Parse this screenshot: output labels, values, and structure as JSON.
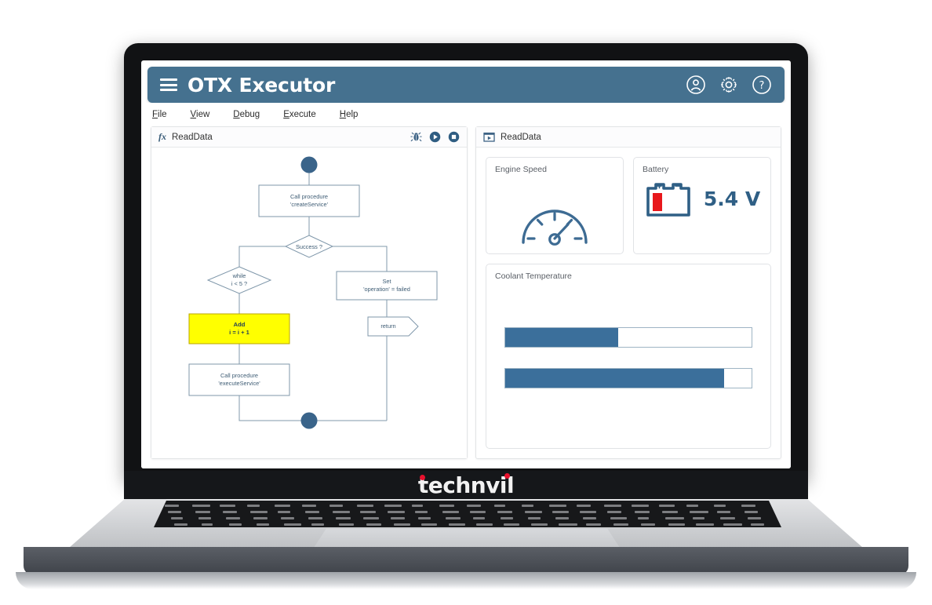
{
  "app": {
    "title": "OTX Executor",
    "menu_icon": "hamburger-icon",
    "header_icons": [
      {
        "name": "account-icon",
        "label": "Account"
      },
      {
        "name": "settings-gear-icon",
        "label": "Settings"
      },
      {
        "name": "help-icon",
        "label": "Help"
      }
    ],
    "menubar": [
      {
        "label": "File",
        "accel": "F"
      },
      {
        "label": "View",
        "accel": "V"
      },
      {
        "label": "Debug",
        "accel": "D"
      },
      {
        "label": "Execute",
        "accel": "E"
      },
      {
        "label": "Help",
        "accel": "H"
      }
    ]
  },
  "editor_panel": {
    "icon": "fx-icon",
    "fx_label": "fx",
    "title": "ReadData",
    "tools": [
      {
        "name": "debug-bug-icon",
        "label": "Debug"
      },
      {
        "name": "run-play-icon",
        "label": "Run"
      },
      {
        "name": "stop-square-icon",
        "label": "Stop"
      }
    ],
    "flow": {
      "nodes": [
        {
          "id": "start",
          "type": "start-node",
          "label": ""
        },
        {
          "id": "call1",
          "type": "process-node",
          "label": "Call procedure\n'createService'"
        },
        {
          "id": "dec1",
          "type": "decision-node",
          "label": "Success ?"
        },
        {
          "id": "dec2",
          "type": "decision-node",
          "label": "while\ni < 5 ?"
        },
        {
          "id": "set1",
          "type": "process-node",
          "label": "Set\n'operation' = failed"
        },
        {
          "id": "add1",
          "type": "highlighted-node",
          "label": "Add\ni = i + 1",
          "highlight": "#FFFF00"
        },
        {
          "id": "ret1",
          "type": "return-node",
          "label": "return"
        },
        {
          "id": "call2",
          "type": "process-node",
          "label": "Call procedure\n'executeService'"
        },
        {
          "id": "end",
          "type": "end-node",
          "label": ""
        }
      ]
    }
  },
  "monitor_panel": {
    "icon": "screen-play-icon",
    "title": "ReadData",
    "cards": [
      {
        "title": "Engine Speed",
        "widget": "gauge-icon"
      },
      {
        "title": "Battery",
        "widget": "battery-icon",
        "value": "5.4 V",
        "fill_percent": 25
      },
      {
        "title": "Coolant Temperature",
        "widget": "progress-bars",
        "bars": [
          {
            "percent": 46
          },
          {
            "percent": 89
          }
        ]
      }
    ]
  },
  "device": {
    "brand": "technvil"
  },
  "colors": {
    "header_blue": "#45718f",
    "flow_stroke": "#7c95a8",
    "flow_text": "#3f5d75",
    "accent_node": "#FFFF00",
    "bar_fill": "#3b6f9b",
    "battery_red": "#e8181c",
    "brand_red": "#e8112d"
  }
}
